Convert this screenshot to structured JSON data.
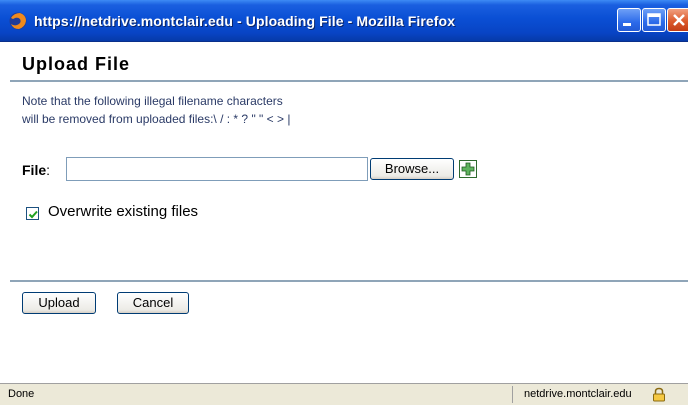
{
  "window": {
    "title": "https://netdrive.montclair.edu - Uploading File - Mozilla Firefox",
    "icon": "firefox-icon"
  },
  "page": {
    "title": "Upload File",
    "note_line1": "Note that the following illegal filename characters",
    "note_line2": "will be removed from uploaded files:\\ / : * ? \" \" < > |"
  },
  "form": {
    "file_label": "File",
    "file_colon": ":",
    "file_value": "",
    "browse_label": "Browse...",
    "add_icon": "add-file-icon",
    "overwrite_label": "Overwrite existing files",
    "overwrite_checked": true,
    "upload_label": "Upload",
    "cancel_label": "Cancel"
  },
  "statusbar": {
    "status": "Done",
    "domain": "netdrive.montclair.edu",
    "lock_icon": "lock-icon"
  },
  "colors": {
    "titlebar": "#0a4fd4",
    "separator": "#8fa5b8",
    "note_text": "#2a3a66"
  }
}
